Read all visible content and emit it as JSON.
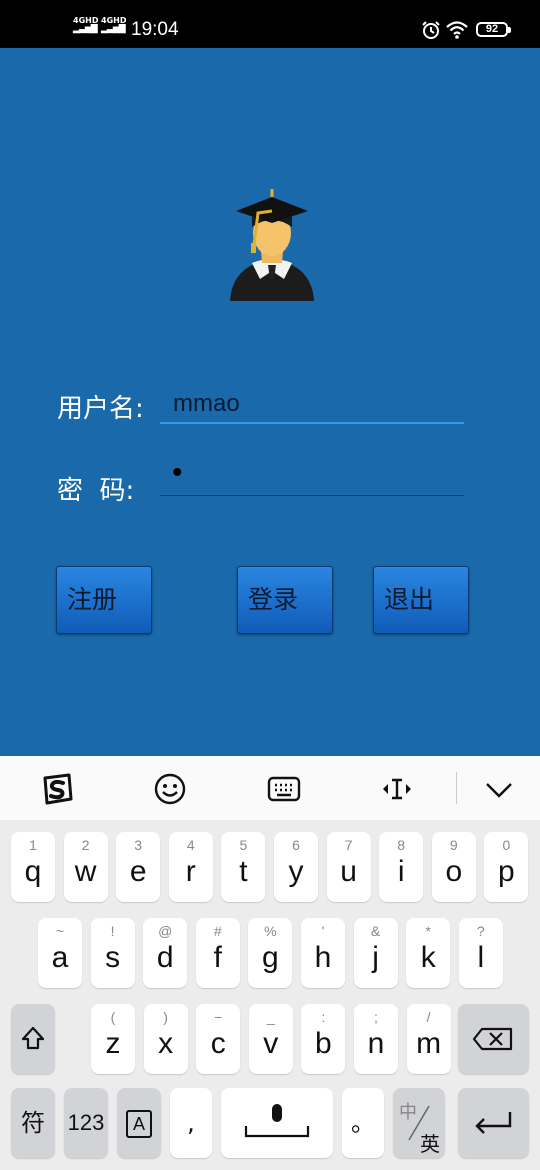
{
  "status_bar": {
    "signal_1": "4GHD",
    "signal_2": "4GHD",
    "time": "19:04",
    "battery": "92"
  },
  "login": {
    "username_label": "用户名:",
    "username_value": "mmao",
    "password_label": "密  码:",
    "password_value": "•",
    "buttons": {
      "register": "注册",
      "login": "登录",
      "exit": "退出"
    }
  },
  "keyboard": {
    "toolbar_icons": [
      "sogou-logo-icon",
      "emoji-icon",
      "keyboard-icon",
      "cursor-move-icon",
      "collapse-chevron-icon"
    ],
    "row1": [
      {
        "main": "q",
        "sub": "1"
      },
      {
        "main": "w",
        "sub": "2"
      },
      {
        "main": "e",
        "sub": "3"
      },
      {
        "main": "r",
        "sub": "4"
      },
      {
        "main": "t",
        "sub": "5"
      },
      {
        "main": "y",
        "sub": "6"
      },
      {
        "main": "u",
        "sub": "7"
      },
      {
        "main": "i",
        "sub": "8"
      },
      {
        "main": "o",
        "sub": "9"
      },
      {
        "main": "p",
        "sub": "0"
      }
    ],
    "row2": [
      {
        "main": "a",
        "sub": "~"
      },
      {
        "main": "s",
        "sub": "!"
      },
      {
        "main": "d",
        "sub": "@"
      },
      {
        "main": "f",
        "sub": "#"
      },
      {
        "main": "g",
        "sub": "%"
      },
      {
        "main": "h",
        "sub": "'"
      },
      {
        "main": "j",
        "sub": "&"
      },
      {
        "main": "k",
        "sub": "*"
      },
      {
        "main": "l",
        "sub": "?"
      }
    ],
    "row3": [
      {
        "main": "z",
        "sub": "("
      },
      {
        "main": "x",
        "sub": ")"
      },
      {
        "main": "c",
        "sub": "−"
      },
      {
        "main": "v",
        "sub": "_"
      },
      {
        "main": "b",
        "sub": ":"
      },
      {
        "main": "n",
        "sub": ";"
      },
      {
        "main": "m",
        "sub": "/"
      }
    ],
    "bottom": {
      "symbols": "符",
      "numbers": "123",
      "mode": "A",
      "comma": ",",
      "period": "。",
      "lang_top": "中",
      "lang_bottom": "英"
    },
    "colors": {
      "accent": "#1a69aa",
      "underline_active": "#2aa0e8"
    }
  }
}
